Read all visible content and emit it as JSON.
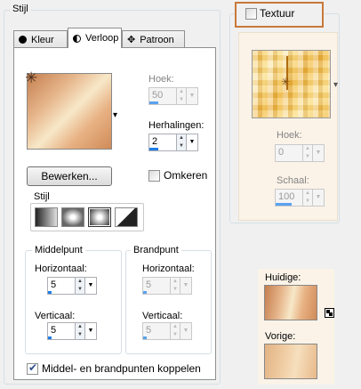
{
  "stijl_group": {
    "title": "Stijl"
  },
  "tabs": [
    {
      "label": "Kleur",
      "icon": "filled-circle-icon"
    },
    {
      "label": "Verloop",
      "icon": "half-circle-icon"
    },
    {
      "label": "Patroon",
      "icon": "pattern-icon"
    }
  ],
  "gradient": {
    "colors": [
      "#c47f4f",
      "#e6b48a",
      "#f7e8c8",
      "#e8b183",
      "#d08b58"
    ],
    "dropdown_arrow": "▾"
  },
  "hoek": {
    "label": "Hoek:",
    "value": "50"
  },
  "herhalingen": {
    "label": "Herhalingen:",
    "value": "2"
  },
  "bewerken_label": "Bewerken...",
  "omkeren_label": "Omkeren",
  "stijl_sub": {
    "label": "Stijl"
  },
  "middelpunt": {
    "title": "Middelpunt",
    "horizontaal_label": "Horizontaal:",
    "horizontaal_value": "5",
    "verticaal_label": "Verticaal:",
    "verticaal_value": "5"
  },
  "brandpunt": {
    "title": "Brandpunt",
    "horizontaal_label": "Horizontaal:",
    "horizontaal_value": "5",
    "verticaal_label": "Verticaal:",
    "verticaal_value": "5"
  },
  "koppelen_label": "Middel- en brandpunten koppelen",
  "textuur": {
    "label": "Textuur",
    "hoek_label": "Hoek:",
    "hoek_value": "0",
    "schaal_label": "Schaal:",
    "schaal_value": "100"
  },
  "huidige_label": "Huidige:",
  "vorige_label": "Vorige:",
  "accent_color": "#c8793a"
}
